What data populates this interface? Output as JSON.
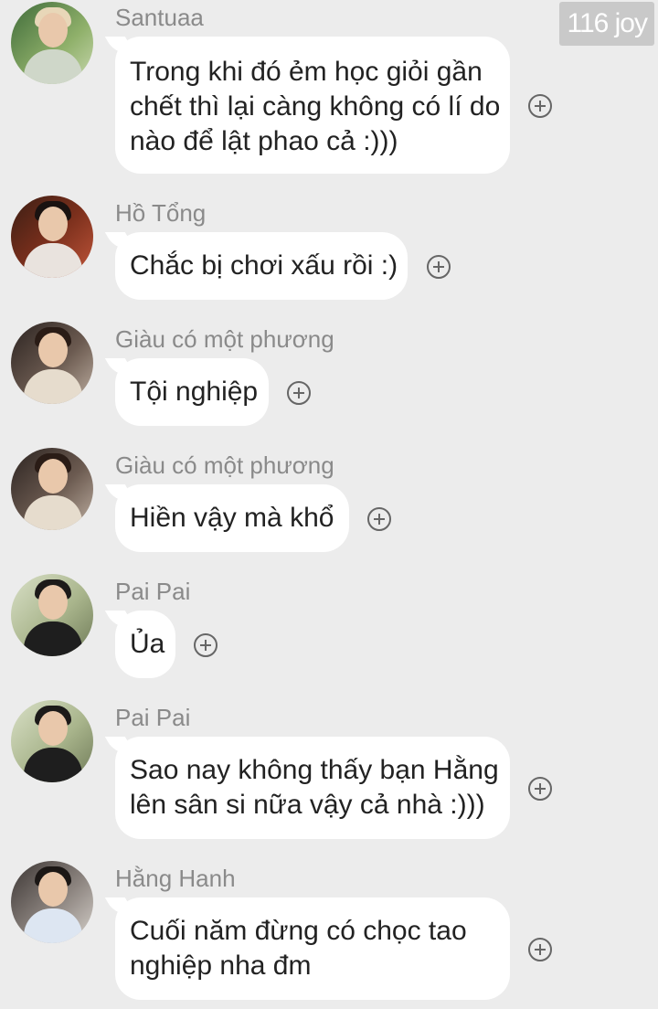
{
  "watermark": "116 joy",
  "messages": [
    {
      "sender": "Santuaa",
      "lines": [
        "Trong khi đó ẻm học giỏi gần",
        "chết thì lại càng không có lí do",
        "nào để lật phao cả :)))"
      ]
    },
    {
      "sender": "Hồ Tổng",
      "lines": [
        "Chắc bị chơi xấu rồi :)"
      ]
    },
    {
      "sender": "Giàu có một phương",
      "lines": [
        "Tội nghiệp"
      ]
    },
    {
      "sender": "Giàu có một phương",
      "lines": [
        "Hiền vậy mà khổ"
      ]
    },
    {
      "sender": "Pai Pai",
      "lines": [
        "Ủa"
      ]
    },
    {
      "sender": "Pai Pai",
      "lines": [
        "Sao nay không thấy bạn Hằng",
        "lên sân si nữa vậy cả nhà :)))"
      ]
    },
    {
      "sender": "Hằng Hanh",
      "lines": [
        "Cuối năm đừng có chọc tao",
        "nghiệp nha đm"
      ]
    }
  ]
}
